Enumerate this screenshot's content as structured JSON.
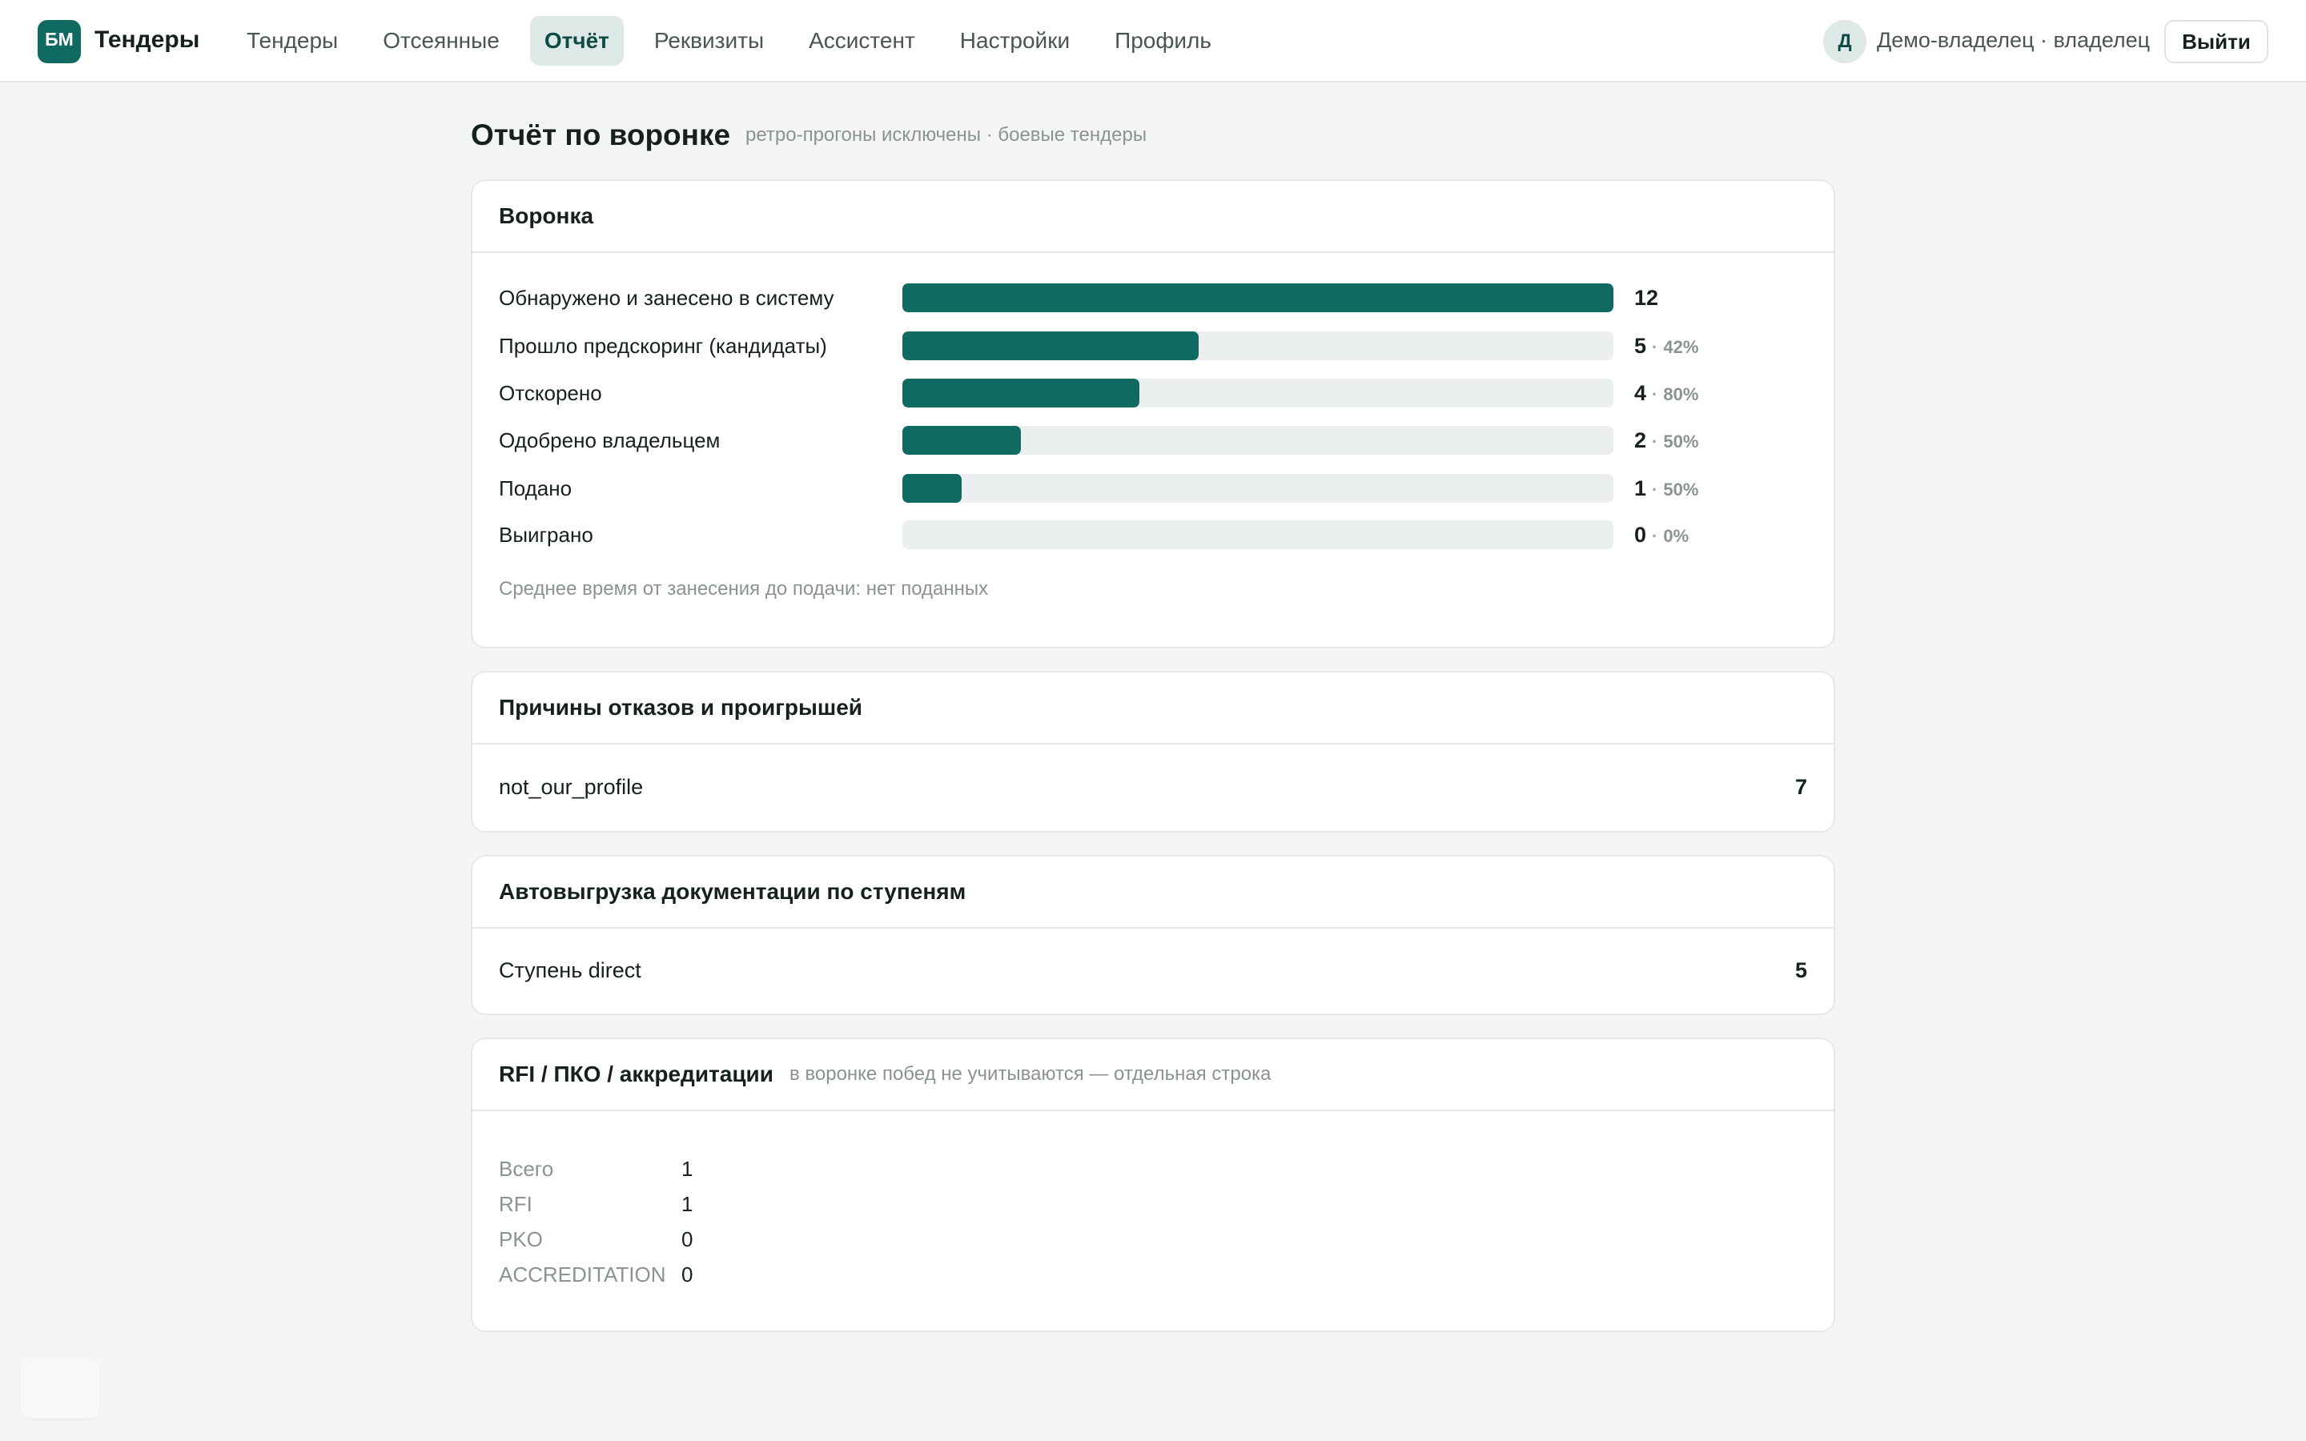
{
  "header": {
    "logo_text": "БМ",
    "brand": "Тендеры",
    "nav": [
      {
        "label": "Тендеры",
        "active": false
      },
      {
        "label": "Отсеянные",
        "active": false
      },
      {
        "label": "Отчёт",
        "active": true
      },
      {
        "label": "Реквизиты",
        "active": false
      },
      {
        "label": "Ассистент",
        "active": false
      },
      {
        "label": "Настройки",
        "active": false
      },
      {
        "label": "Профиль",
        "active": false
      }
    ],
    "avatar_letter": "Д",
    "user": "Демо-владелец · владелец",
    "logout": "Выйти"
  },
  "page": {
    "title": "Отчёт по воронке",
    "subtitle": "ретро-прогоны исключены · боевые тендеры"
  },
  "funnel": {
    "title": "Воронка",
    "rows": [
      {
        "label": "Обнаружено и занесено в систему",
        "count": "12",
        "pct": "",
        "fraction": 1.0
      },
      {
        "label": "Прошло предскоринг (кандидаты)",
        "count": "5",
        "pct": "42%",
        "fraction": 0.4167
      },
      {
        "label": "Отскорено",
        "count": "4",
        "pct": "80%",
        "fraction": 0.3333
      },
      {
        "label": "Одобрено владельцем",
        "count": "2",
        "pct": "50%",
        "fraction": 0.1667
      },
      {
        "label": "Подано",
        "count": "1",
        "pct": "50%",
        "fraction": 0.0833
      },
      {
        "label": "Выиграно",
        "count": "0",
        "pct": "0%",
        "fraction": 0
      }
    ],
    "footnote": "Среднее время от занесения до подачи: нет поданных"
  },
  "reasons": {
    "title": "Причины отказов и проигрышей",
    "rows": [
      {
        "label": "not_our_profile",
        "value": "7"
      }
    ]
  },
  "autoload": {
    "title": "Автовыгрузка документации по ступеням",
    "rows": [
      {
        "label": "Ступень direct",
        "value": "5"
      }
    ]
  },
  "rfi": {
    "title": "RFI / ПКО / аккредитации",
    "note": "в воронке побед не учитываются — отдельная строка",
    "rows": [
      {
        "key": "Всего",
        "value": "1"
      },
      {
        "key": "RFI",
        "value": "1"
      },
      {
        "key": "PKO",
        "value": "0"
      },
      {
        "key": "ACCREDITATION",
        "value": "0"
      }
    ]
  },
  "colors": {
    "accent": "#0f6b62",
    "track": "#eceff0",
    "background": "#f4f6f5",
    "muted_text": "#8a9391"
  }
}
